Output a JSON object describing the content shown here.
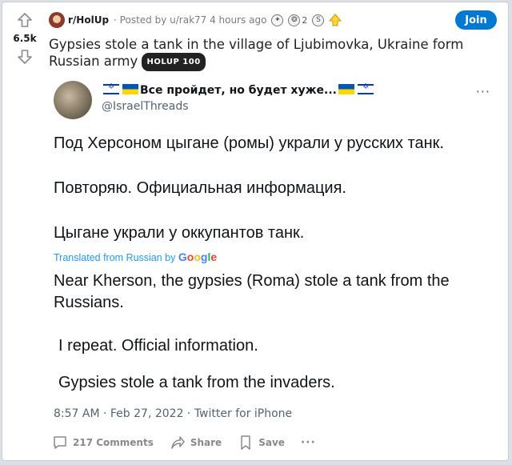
{
  "post": {
    "vote_count": "6.5k",
    "subreddit": "r/HolUp",
    "meta": "· Posted by u/rak77 4 hours ago",
    "award_count": "2",
    "join_label": "Join",
    "title": "Gypsies stole a tank in the village of Ljubimovka, Ukraine form Russian army",
    "flair": "HOLUP 100"
  },
  "tweet": {
    "display_name": "Все пройдет, но будет хуже...",
    "handle": "@IsraelThreads",
    "more": "···",
    "ru_line1": "Под Херсоном цыгане (ромы) украли у русских танк.",
    "ru_line2": "Повторяю. Официальная информация.",
    "ru_line3": "Цыгане украли у оккупантов танк.",
    "translated_label": "Translated from Russian by",
    "google": [
      "G",
      "o",
      "o",
      "g",
      "l",
      "e"
    ],
    "en_line1": "Near Kherson, the gypsies (Roma) stole a tank from the Russians.",
    "en_line2": "I repeat. Official information.",
    "en_line3": "Gypsies stole a tank from the invaders.",
    "timestamp": "8:57 AM · Feb 27, 2022 · Twitter for iPhone"
  },
  "actions": {
    "comments": "217 Comments",
    "share": "Share",
    "save": "Save",
    "more": "···"
  },
  "colors": {
    "join": "#0079d3",
    "link": "#1d9bf0"
  },
  "icons": [
    "upvote-icon",
    "downvote-icon",
    "award-icon",
    "comment-icon",
    "share-icon",
    "save-icon",
    "more-icon"
  ]
}
